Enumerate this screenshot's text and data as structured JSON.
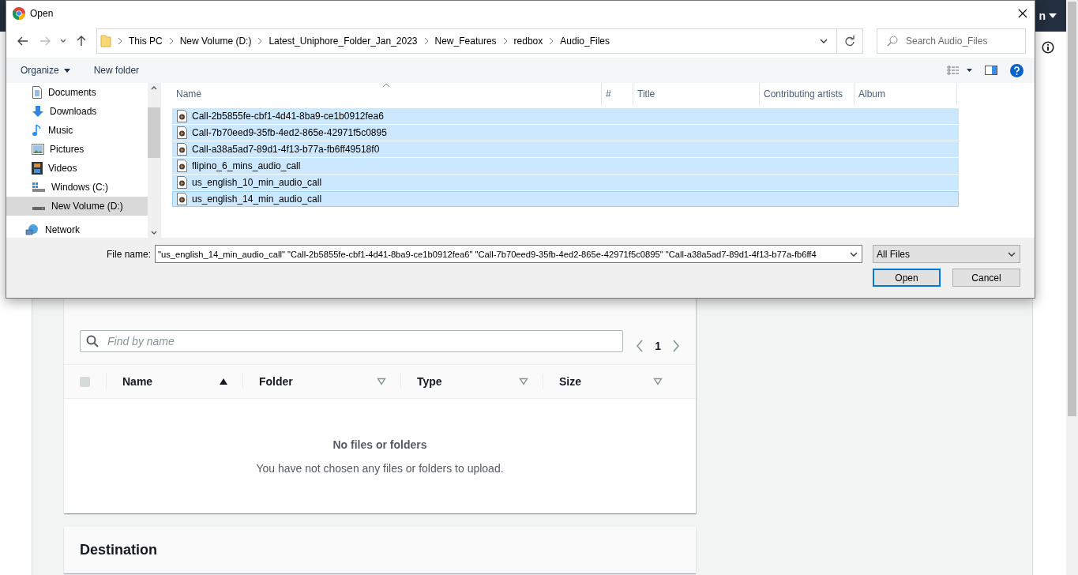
{
  "top_bar": {
    "account_label": "n"
  },
  "upload": {
    "search": {
      "placeholder": "Find by name"
    },
    "pager": {
      "page": "1"
    },
    "select_all": {
      "checked": false
    },
    "columns": [
      {
        "label": "Name",
        "sorted": true
      },
      {
        "label": "Folder",
        "sorted": false
      },
      {
        "label": "Type",
        "sorted": false
      },
      {
        "label": "Size",
        "sorted": false
      }
    ],
    "empty": {
      "title": "No files or folders",
      "message": "You have not chosen any files or folders to upload."
    }
  },
  "destination": {
    "title": "Destination"
  },
  "dialog": {
    "title": "Open",
    "breadcrumb": [
      "This PC",
      "New Volume (D:)",
      "Latest_Uniphore_Folder_Jan_2023",
      "New_Features",
      "redbox",
      "Audio_Files"
    ],
    "search": {
      "placeholder": "Search Audio_Files"
    },
    "toolbar": {
      "organize": "Organize",
      "new_folder": "New folder"
    },
    "sidebar": {
      "items": [
        {
          "label": "Documents",
          "kind": "documents",
          "selected": false
        },
        {
          "label": "Downloads",
          "kind": "downloads",
          "selected": false
        },
        {
          "label": "Music",
          "kind": "music",
          "selected": false
        },
        {
          "label": "Pictures",
          "kind": "pictures",
          "selected": false
        },
        {
          "label": "Videos",
          "kind": "videos",
          "selected": false
        },
        {
          "label": "Windows (C:)",
          "kind": "system_drive",
          "selected": false
        },
        {
          "label": "New Volume (D:)",
          "kind": "drive",
          "selected": true
        }
      ],
      "network": {
        "label": "Network",
        "selected": false
      }
    },
    "columns": [
      "Name",
      "#",
      "Title",
      "Contributing artists",
      "Album"
    ],
    "files": [
      {
        "name": "Call-2b5855fe-cbf1-4d41-8ba9-ce1b0912fea6",
        "selected": true,
        "focused": false
      },
      {
        "name": "Call-7b70eed9-35fb-4ed2-865e-42971f5c0895",
        "selected": true,
        "focused": false
      },
      {
        "name": "Call-a38a5ad7-89d1-4f13-b77a-fb6ff49518f0",
        "selected": true,
        "focused": false
      },
      {
        "name": "flipino_6_mins_audio_call",
        "selected": true,
        "focused": false
      },
      {
        "name": "us_english_10_min_audio_call",
        "selected": true,
        "focused": false
      },
      {
        "name": "us_english_14_min_audio_call",
        "selected": true,
        "focused": true
      }
    ],
    "file_name": {
      "label": "File name:",
      "value": "\"us_english_14_min_audio_call\" \"Call-2b5855fe-cbf1-4d41-8ba9-ce1b0912fea6\" \"Call-7b70eed9-35fb-4ed2-865e-42971f5c0895\" \"Call-a38a5ad7-89d1-4f13-b77a-fb6ff4"
    },
    "file_type": {
      "value": "All Files"
    },
    "buttons": [
      {
        "label": "Open",
        "default": true
      },
      {
        "label": "Cancel",
        "default": false
      }
    ]
  }
}
